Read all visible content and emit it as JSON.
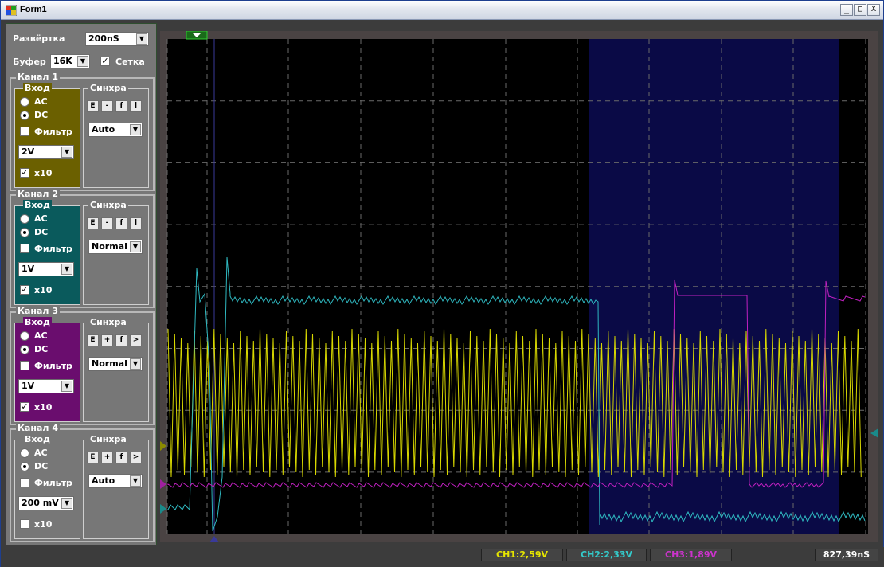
{
  "window": {
    "title": "Form1",
    "min": "_",
    "max": "□",
    "close": "X"
  },
  "controls": {
    "sweep_label": "Развёртка",
    "sweep_value": "200nS",
    "buffer_label": "Буфер",
    "buffer_value": "16K",
    "grid_label": "Сетка",
    "grid_checked": true
  },
  "channels": [
    {
      "name": "Канал 1",
      "input_label": "Вход",
      "ac": "AC",
      "dc": "DC",
      "filter": "Фильтр",
      "volts": "2V",
      "x10": "x10",
      "x10_checked": true,
      "sync_label": "Синхра",
      "sync_buttons": [
        "E",
        "-",
        "f",
        "l"
      ],
      "sync_mode": "Auto",
      "color": "#6b6000"
    },
    {
      "name": "Канал 2",
      "input_label": "Вход",
      "ac": "AC",
      "dc": "DC",
      "filter": "Фильтр",
      "volts": "1V",
      "x10": "x10",
      "x10_checked": true,
      "sync_label": "Синхра",
      "sync_buttons": [
        "E",
        "-",
        "f",
        "l"
      ],
      "sync_mode": "Normal",
      "color": "#0a5a5c"
    },
    {
      "name": "Канал 3",
      "input_label": "Вход",
      "ac": "AC",
      "dc": "DC",
      "filter": "Фильтр",
      "volts": "1V",
      "x10": "x10",
      "x10_checked": true,
      "sync_label": "Синхра",
      "sync_buttons": [
        "E",
        "+",
        "f",
        ">"
      ],
      "sync_mode": "Normal",
      "color": "#6a0d6e"
    },
    {
      "name": "Канал 4",
      "input_label": "Вход",
      "ac": "AC",
      "dc": "DC",
      "filter": "Фильтр",
      "volts": "200 mV",
      "x10": "x10",
      "x10_checked": false,
      "sync_label": "Синхра",
      "sync_buttons": [
        "E",
        "+",
        "f",
        ">"
      ],
      "sync_mode": "Auto",
      "color": "#777777"
    }
  ],
  "status": {
    "ch1": "CH1:2,59V",
    "ch1_color": "#e6e600",
    "ch2": "CH2:2,33V",
    "ch2_color": "#33cccc",
    "ch3": "CH3:1,89V",
    "ch3_color": "#cc33cc",
    "time": "827,39nS"
  },
  "icons": {
    "checked": "✓",
    "arrow": "▼"
  }
}
